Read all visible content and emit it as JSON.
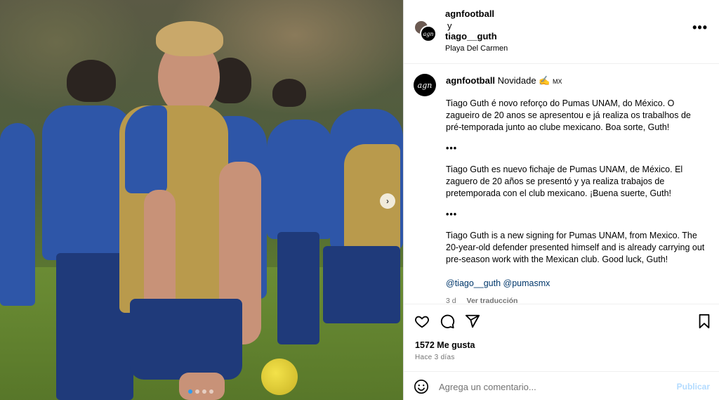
{
  "post": {
    "header": {
      "user1": "agnfootball",
      "connector": "y",
      "user2": "tiago__guth",
      "location": "Playa Del Carmen",
      "avatar_text": "agn",
      "more_icon": "more-horizontal-icon"
    },
    "caption": {
      "avatar_text": "agn",
      "username": "agnfootball",
      "headline": "Novidade ✍️",
      "flag": "MX",
      "paragraphs": [
        "Tiago Guth é novo reforço do Pumas UNAM, do México. O zagueiro de 20 anos se apresentou e já realiza os trabalhos de pré-temporada junto ao clube mexicano. Boa sorte, Guth!",
        "Tiago Guth es nuevo fichaje de Pumas UNAM, de México. El zaguero de 20 años se presentó y ya realiza trabajos de pretemporada con el club mexicano. ¡Buena suerte, Guth!",
        "Tiago Guth is a new signing for Pumas UNAM, from Mexico. The 20-year-old defender presented himself and is already carrying out pre-season work with the Mexican club. Good luck, Guth!"
      ],
      "separator": "•••",
      "mentions": "@tiago__guth @pumasmx",
      "age": "3 d",
      "translate": "Ver traducción"
    },
    "stats": {
      "likes": "1572 Me gusta",
      "posted": "Hace 3 días"
    },
    "comment": {
      "placeholder": "Agrega un comentario...",
      "submit": "Publicar"
    },
    "carousel": {
      "slide_count": 4,
      "active_index": 0
    }
  },
  "colors": {
    "link": "#00376b",
    "muted": "#737373",
    "publish_disabled": "#b3dbff",
    "active_dot": "#2f9cf0"
  }
}
